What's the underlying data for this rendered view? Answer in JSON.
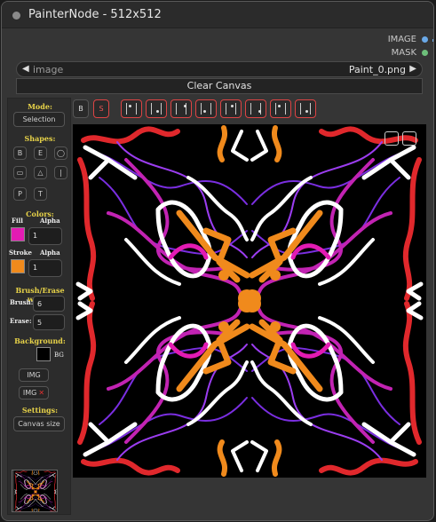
{
  "node": {
    "title": "PainterNode - 512x512",
    "outputs": [
      {
        "label": "IMAGE",
        "color": "#6aa9e8",
        "icon": "output-dot-icon"
      },
      {
        "label": "MASK",
        "color": "#6dbf7a",
        "icon": "output-dot-icon"
      }
    ]
  },
  "image_combo": {
    "label": "image",
    "value": "Paint_0.png",
    "left_arrow": "◀",
    "right_arrow": "▶"
  },
  "clear_button": "Clear Canvas",
  "sidebar": {
    "mode_title": "Mode:",
    "mode_button": "Selection",
    "shapes_title": "Shapes:",
    "shape_buttons": [
      "B",
      "E",
      "◯",
      "▭",
      "△",
      "|",
      "P",
      "T"
    ],
    "colors_title": "Colors:",
    "fill_label": "Fill",
    "fill_alpha_label": "Alpha",
    "fill_color": "#e31bb3",
    "fill_alpha": "1",
    "stroke_label": "Stroke",
    "stroke_alpha_label": "Alpha",
    "stroke_color": "#f08a1c",
    "stroke_alpha": "1",
    "brush_title": "Brush/Erase width:",
    "brush_label": "Brush:",
    "brush_value": "6",
    "erase_label": "Erase:",
    "erase_value": "5",
    "background_title": "Background:",
    "bg_color": "#000000",
    "bg_label": "BG",
    "img_button": "IMG",
    "img_remove_button": "IMG",
    "img_remove_icon": "✕",
    "settings_title": "Settings:",
    "canvas_size_button": "Canvas size"
  },
  "toolbar": {
    "bold_button": "B",
    "s_button": "S",
    "symmetry_buttons": [
      "sym-1",
      "sym-2",
      "sym-3",
      "sym-4",
      "sym-5",
      "sym-6",
      "sym-7",
      "sym-8"
    ]
  }
}
